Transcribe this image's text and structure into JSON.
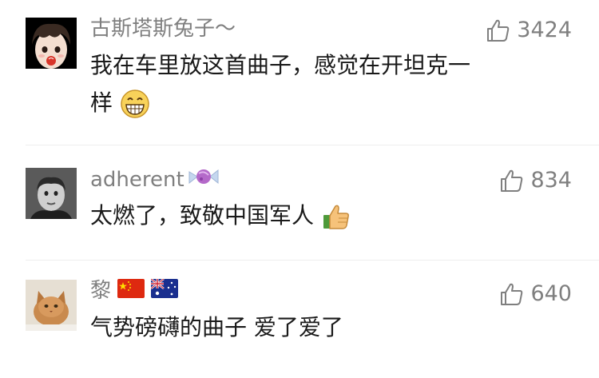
{
  "comments": [
    {
      "username": "古斯塔斯兔子～",
      "likes": "3424",
      "text_line1": "我在车里放这首曲子，感觉在开坦克一",
      "text_line2": "样",
      "emoji": "grin-emoji"
    },
    {
      "username": "adherent",
      "username_decoration": "candy-icon",
      "likes": "834",
      "text": "太燃了，致敬中国军人",
      "emoji": "thumbs-up-emoji"
    },
    {
      "username": "黎",
      "username_decoration": [
        "china-flag-icon",
        "australia-flag-icon"
      ],
      "likes": "640",
      "text": "气势磅礴的曲子 爱了爱了"
    }
  ],
  "colors": {
    "username": "#7f7f7f",
    "body_text": "#1a1a1a",
    "like_icon": "#7f7f7f"
  }
}
